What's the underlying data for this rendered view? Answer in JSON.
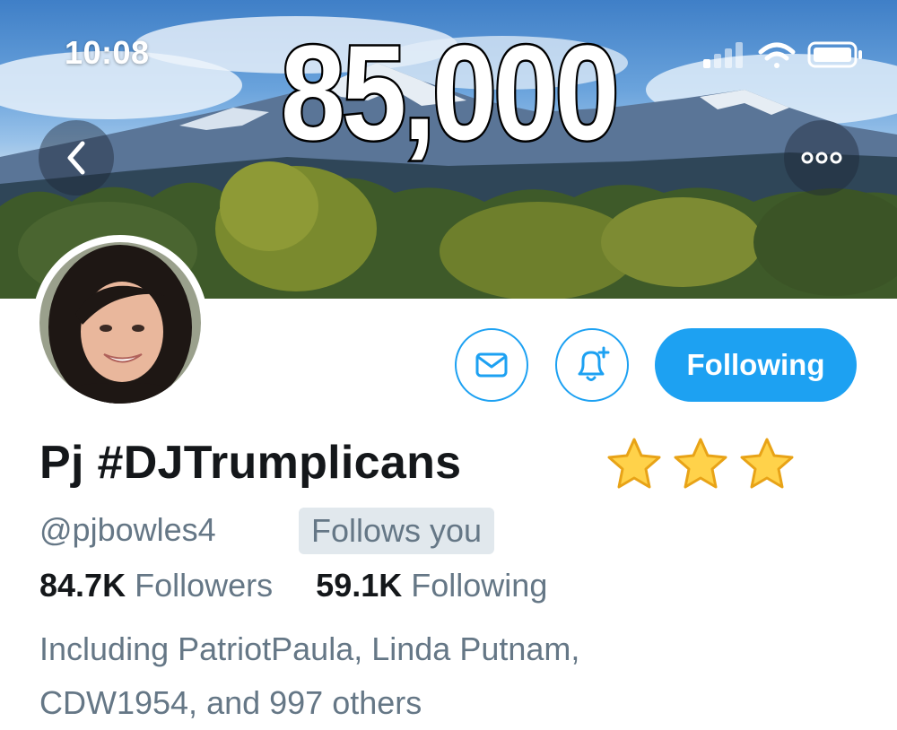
{
  "status_bar": {
    "time": "10:08",
    "icons": [
      "cellular-signal-icon",
      "wifi-icon",
      "battery-icon"
    ]
  },
  "banner": {
    "overlay_text": "85,000"
  },
  "nav": {
    "back_icon": "chevron-left-icon",
    "more_icon": "more-dots-icon"
  },
  "actions": {
    "message_icon": "envelope-icon",
    "notify_icon": "bell-plus-icon",
    "follow_label": "Following"
  },
  "profile": {
    "display_name": "Pj #DJTrumplicans",
    "emoji": [
      "⭐",
      "⭐",
      "⭐"
    ],
    "handle": "@pjbowles4",
    "follows_you": "Follows you",
    "followers_count": "84.7K",
    "followers_label": "Followers",
    "following_count": "59.1K",
    "following_label": "Following",
    "known_followers": "Including PatriotPaula, Linda Putnam, CDW1954, and 997 others"
  },
  "colors": {
    "accent": "#1da1f2",
    "text_primary": "#14171a",
    "text_secondary": "#657786",
    "badge_bg": "#e1e8ed",
    "star": "#ffcc33"
  }
}
